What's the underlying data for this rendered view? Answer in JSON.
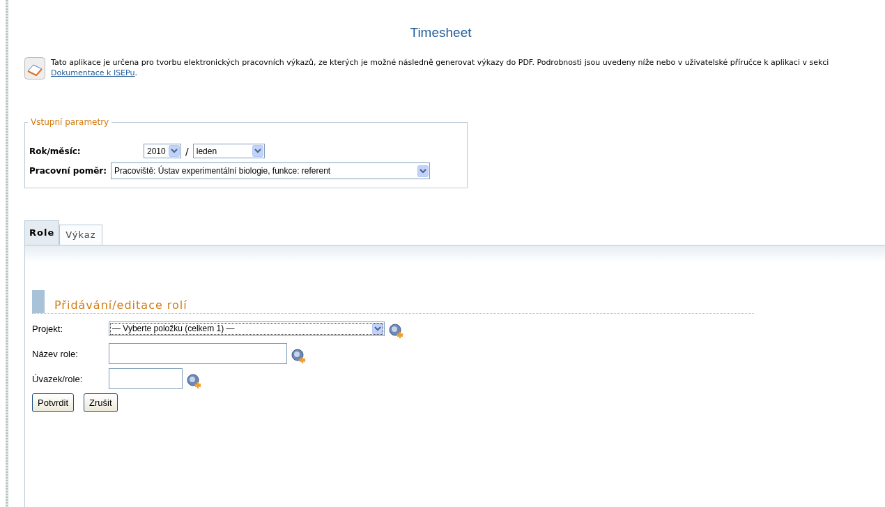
{
  "title": "Timesheet",
  "intro": {
    "text": "Tato aplikace je určena pro tvorbu elektronických pracovních výkazů, ze kterých je možné následně generovat výkazy do PDF. Podrobnosti jsou uvedeny níže nebo v uživatelské příručce k aplikaci v sekci ",
    "link": "Dokumentace k ISEPu",
    "end": "."
  },
  "parameters": {
    "legend": "Vstupní parametry",
    "year_month": {
      "label": "Rok/měsíc:",
      "year": "2010",
      "separator": "/",
      "month": "leden"
    },
    "employment": {
      "label": "Pracovní poměr:",
      "value": "Pracoviště: Ústav experimentální biologie, funkce: referent"
    }
  },
  "tabs": [
    {
      "label": "Role",
      "selected": true
    },
    {
      "label": "Výkaz",
      "selected": false
    }
  ],
  "section": {
    "heading": "Přidávání/editace rolí",
    "fields": [
      {
        "kind": "select",
        "label": "Projekt:",
        "value": "— Vyberte položku (celkem 1) —"
      },
      {
        "kind": "text",
        "label": "Název role:"
      },
      {
        "kind": "short",
        "label": "Úvazek/role:"
      }
    ],
    "buttons": [
      "Potvrdit",
      "Zrušit"
    ]
  }
}
